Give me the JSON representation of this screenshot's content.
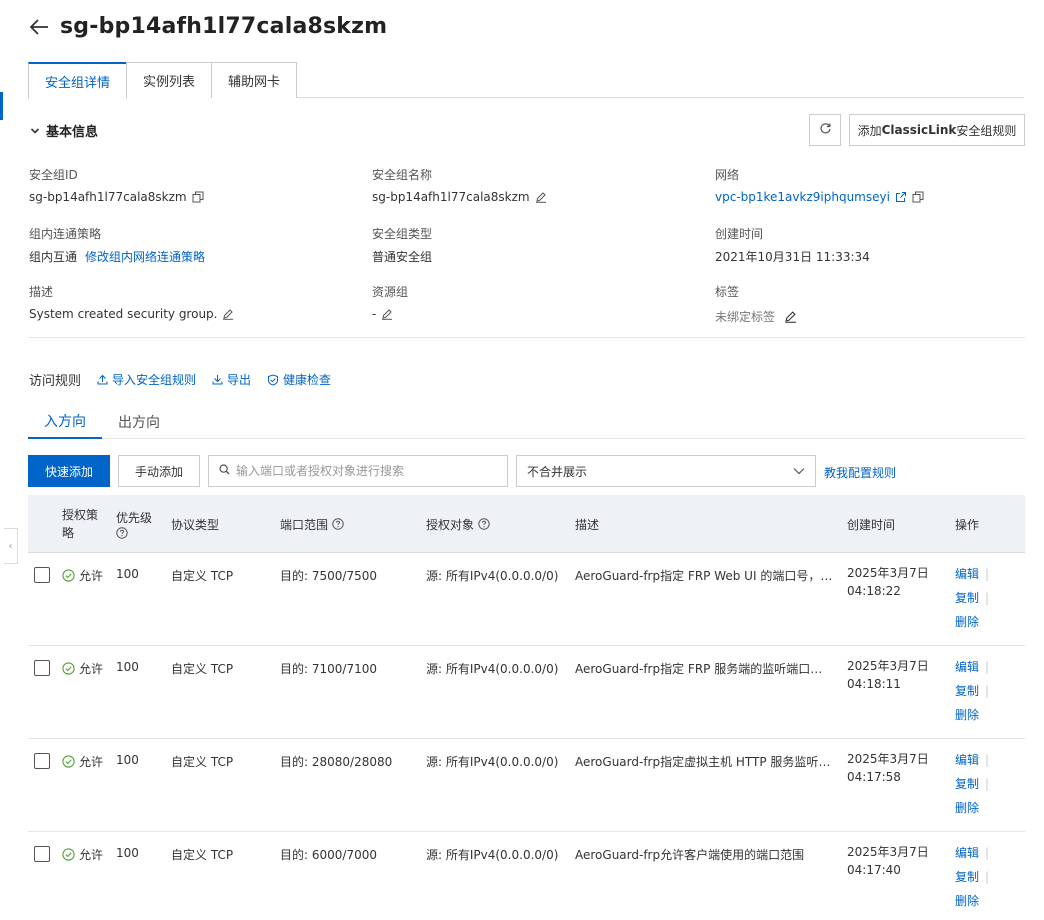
{
  "page": {
    "title": "sg-bp14afh1l77cala8skzm",
    "tabs": [
      "安全组详情",
      "实例列表",
      "辅助网卡"
    ]
  },
  "basic": {
    "title": "基本信息",
    "classiclink_prefix": "添加",
    "classiclink_bold": "ClassicLink",
    "classiclink_suffix": "安全组规则",
    "fields": {
      "sg_id_label": "安全组ID",
      "sg_id_value": "sg-bp14afh1l77cala8skzm",
      "sg_name_label": "安全组名称",
      "sg_name_value": "sg-bp14afh1l77cala8skzm",
      "network_label": "网络",
      "network_value": "vpc-bp1ke1avkz9iphqumseyi",
      "policy_label": "组内连通策略",
      "policy_value": "组内互通",
      "policy_link": "修改组内网络连通策略",
      "type_label": "安全组类型",
      "type_value": "普通安全组",
      "created_label": "创建时间",
      "created_value": "2021年10月31日 11:33:34",
      "desc_label": "描述",
      "desc_value": "System created security group.",
      "rg_label": "资源组",
      "rg_value": "-",
      "tags_label": "标签",
      "tags_value": "未绑定标签"
    }
  },
  "rules": {
    "label": "访问规则",
    "import": "导入安全组规则",
    "export": "导出",
    "health": "健康检查",
    "directions": [
      "入方向",
      "出方向"
    ],
    "quick_add": "快速添加",
    "manual_add": "手动添加",
    "search_placeholder": "输入端口或者授权对象进行搜索",
    "merge_select": "不合并展示",
    "help_link": "教我配置规则"
  },
  "table": {
    "headers": {
      "policy_l1": "授权策",
      "policy_l2": "略",
      "priority": "优先级",
      "protocol": "协议类型",
      "port": "端口范围",
      "source": "授权对象",
      "desc": "描述",
      "created": "创建时间",
      "ops": "操作"
    },
    "ops": {
      "edit": "编辑",
      "copy": "复制",
      "delete": "删除"
    },
    "rows": [
      {
        "policy": "允许",
        "priority": "100",
        "protocol": "自定义 TCP",
        "port": "目的: 7500/7500",
        "source": "源: 所有IPv4(0.0.0.0/0)",
        "desc": "AeroGuard-frp指定 FRP Web UI 的端口号，可...",
        "date": "2025年3月7日",
        "time": "04:18:22"
      },
      {
        "policy": "允许",
        "priority": "100",
        "protocol": "自定义 TCP",
        "port": "目的: 7100/7100",
        "source": "源: 所有IPv4(0.0.0.0/0)",
        "desc": "AeroGuard-frp指定 FRP 服务端的监听端口，客...",
        "date": "2025年3月7日",
        "time": "04:18:11"
      },
      {
        "policy": "允许",
        "priority": "100",
        "protocol": "自定义 TCP",
        "port": "目的: 28080/28080",
        "source": "源: 所有IPv4(0.0.0.0/0)",
        "desc": "AeroGuard-frp指定虚拟主机 HTTP 服务监听的...",
        "date": "2025年3月7日",
        "time": "04:17:58"
      },
      {
        "policy": "允许",
        "priority": "100",
        "protocol": "自定义 TCP",
        "port": "目的: 6000/7000",
        "source": "源: 所有IPv4(0.0.0.0/0)",
        "desc": "AeroGuard-frp允许客户端使用的端口范围",
        "date": "2025年3月7日",
        "time": "04:17:40"
      }
    ]
  },
  "colors": {
    "accent": "#0064c8",
    "success": "#52a334",
    "header_bg": "#eef1f5"
  }
}
